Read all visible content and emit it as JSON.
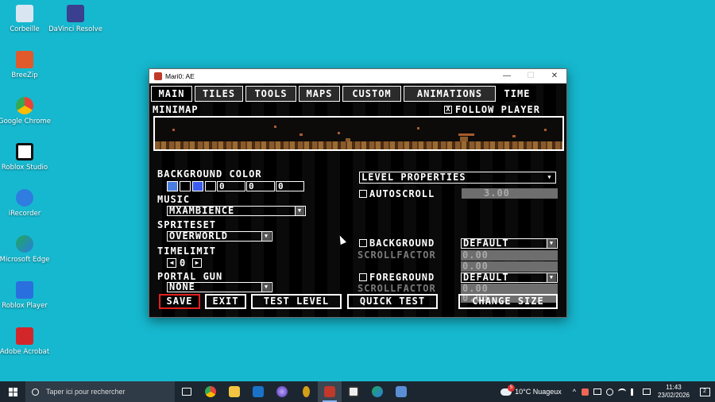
{
  "desktop": {
    "icons": [
      {
        "label": "Corbeille",
        "color": "#d9e6f2"
      },
      {
        "label": "DaVinci Resolve",
        "color": "#3b3f8f"
      },
      {
        "label": "BreeZip",
        "color": "#e05a2b"
      },
      {
        "label": "Google Chrome",
        "color": "#ea4335"
      },
      {
        "label": "Roblox Studio",
        "color": "#ffffff"
      },
      {
        "label": "iRecorder",
        "color": "#2f7de1"
      },
      {
        "label": "Microsoft Edge",
        "color": "#1fa85b"
      },
      {
        "label": "Roblox Player",
        "color": "#2a6fe0"
      },
      {
        "label": "Adobe Acrobat",
        "color": "#d3262a"
      }
    ]
  },
  "window": {
    "title": "Mari0: AE",
    "minimize": "—",
    "maximize": "☐",
    "close": "✕"
  },
  "editor": {
    "tabs": [
      "MAIN",
      "TILES",
      "TOOLS",
      "MAPS",
      "CUSTOM",
      "ANIMATIONS",
      "TIME"
    ],
    "minimap_label": "MINIMAP",
    "follow_player": "FOLLOW PLAYER",
    "follow_player_checked": "X",
    "background_color_label": "BACKGROUND COLOR",
    "bg_swatches": [
      "#4a7de0",
      "#000000",
      "#3b5cf0",
      "#000000"
    ],
    "bg_values": [
      "0",
      "0",
      "0"
    ],
    "music_label": "MUSIC",
    "music_value": "MXAMBIENCE",
    "spriteset_label": "SPRITESET",
    "spriteset_value": "OVERWORLD",
    "timelimit_label": "TIMELIMIT",
    "timelimit_value": "0",
    "portal_gun_label": "PORTAL GUN",
    "portal_gun_value": "NONE",
    "level_properties": "LEVEL PROPERTIES",
    "autoscroll_label": "AUTOSCROLL",
    "autoscroll_value": "3.00",
    "background_label": "BACKGROUND",
    "background_value": "DEFAULT",
    "scrollfactor_label": "SCROLLFACTOR",
    "bg_scroll": [
      "0.00",
      "0.00"
    ],
    "foreground_label": "FOREGROUND",
    "foreground_value": "DEFAULT",
    "fg_scroll": [
      "0.00",
      "0.00"
    ],
    "buttons": {
      "save": "SAVE",
      "exit": "EXIT",
      "test_level": "TEST LEVEL",
      "quick_test": "QUICK TEST",
      "change_size": "CHANGE SIZE"
    }
  },
  "taskbar": {
    "search_placeholder": "Taper ici pour rechercher",
    "weather": "10°C  Nuageux",
    "time": "11:43",
    "date": "23/02/2026",
    "notifications": "2",
    "weather_badge": "5"
  }
}
